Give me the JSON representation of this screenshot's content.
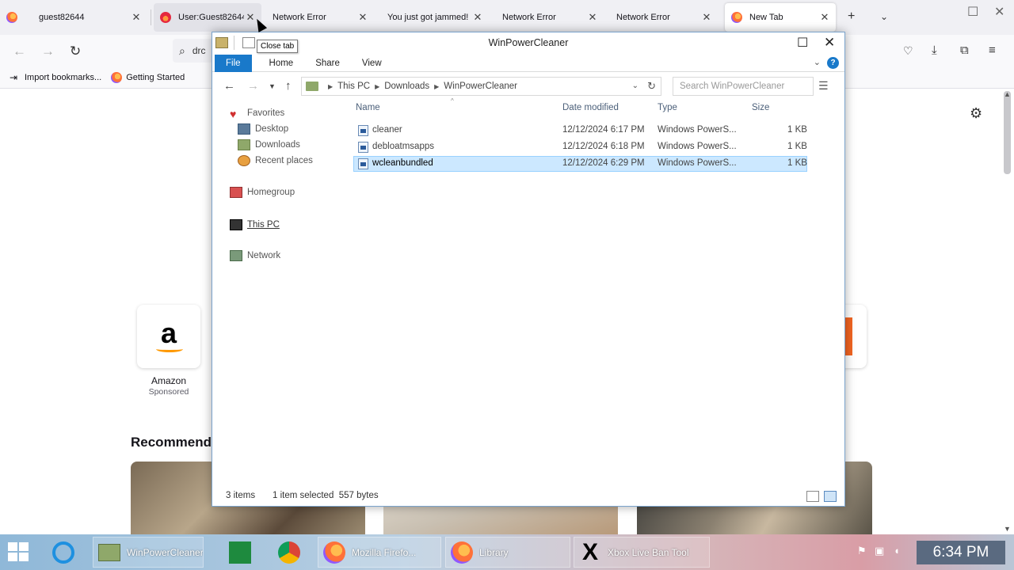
{
  "browser": {
    "tabs": [
      {
        "title": "guest82644",
        "icon": "firefox-icon"
      },
      {
        "title": "User:Guest82644",
        "icon": "flame-icon"
      },
      {
        "title": "Network Error",
        "icon": ""
      },
      {
        "title": "You just got jammed!",
        "icon": ""
      },
      {
        "title": "Network Error",
        "icon": ""
      },
      {
        "title": "Network Error",
        "icon": ""
      },
      {
        "title": "New Tab",
        "icon": "firefox-icon"
      }
    ],
    "url_partial": "drc",
    "bookmarks": [
      {
        "label": "Import bookmarks..."
      },
      {
        "label": "Getting Started"
      }
    ],
    "new_tab": {
      "shortcut_label": "Amazon",
      "shortcut_sub": "Sponsored",
      "shortcut_logo": "a",
      "recommended": "Recommende",
      "partial_label": "t"
    }
  },
  "explorer": {
    "title": "WinPowerCleaner",
    "tooltip": "Close tab",
    "ribbon_tabs": [
      "File",
      "Home",
      "Share",
      "View"
    ],
    "help": "?",
    "breadcrumb": [
      "This PC",
      "Downloads",
      "WinPowerCleaner"
    ],
    "search_placeholder": "Search WinPowerCleaner",
    "nav": {
      "favorites": "Favorites",
      "desktop": "Desktop",
      "downloads": "Downloads",
      "recent": "Recent places",
      "homegroup": "Homegroup",
      "thispc": "This PC",
      "network": "Network"
    },
    "columns": [
      "Name",
      "Date modified",
      "Type",
      "Size"
    ],
    "files": [
      {
        "name": "cleaner",
        "date": "12/12/2024 6:17 PM",
        "type": "Windows PowerS...",
        "size": "1 KB"
      },
      {
        "name": "debloatmsapps",
        "date": "12/12/2024 6:18 PM",
        "type": "Windows PowerS...",
        "size": "1 KB"
      },
      {
        "name": "wcleanbundled",
        "date": "12/12/2024 6:29 PM",
        "type": "Windows PowerS...",
        "size": "1 KB"
      }
    ],
    "status": {
      "items": "3 items",
      "selected": "1 item selected  557 bytes"
    }
  },
  "taskbar": {
    "items": [
      {
        "label": "WinPowerCleaner"
      },
      {
        "label": "Mozilla Firefo..."
      },
      {
        "label": "Library"
      },
      {
        "label": "Xbox Live Ban Tool"
      }
    ],
    "clock": "6:34 PM"
  },
  "colors": {
    "accent": "#1979ca",
    "selection": "#cce8ff"
  }
}
